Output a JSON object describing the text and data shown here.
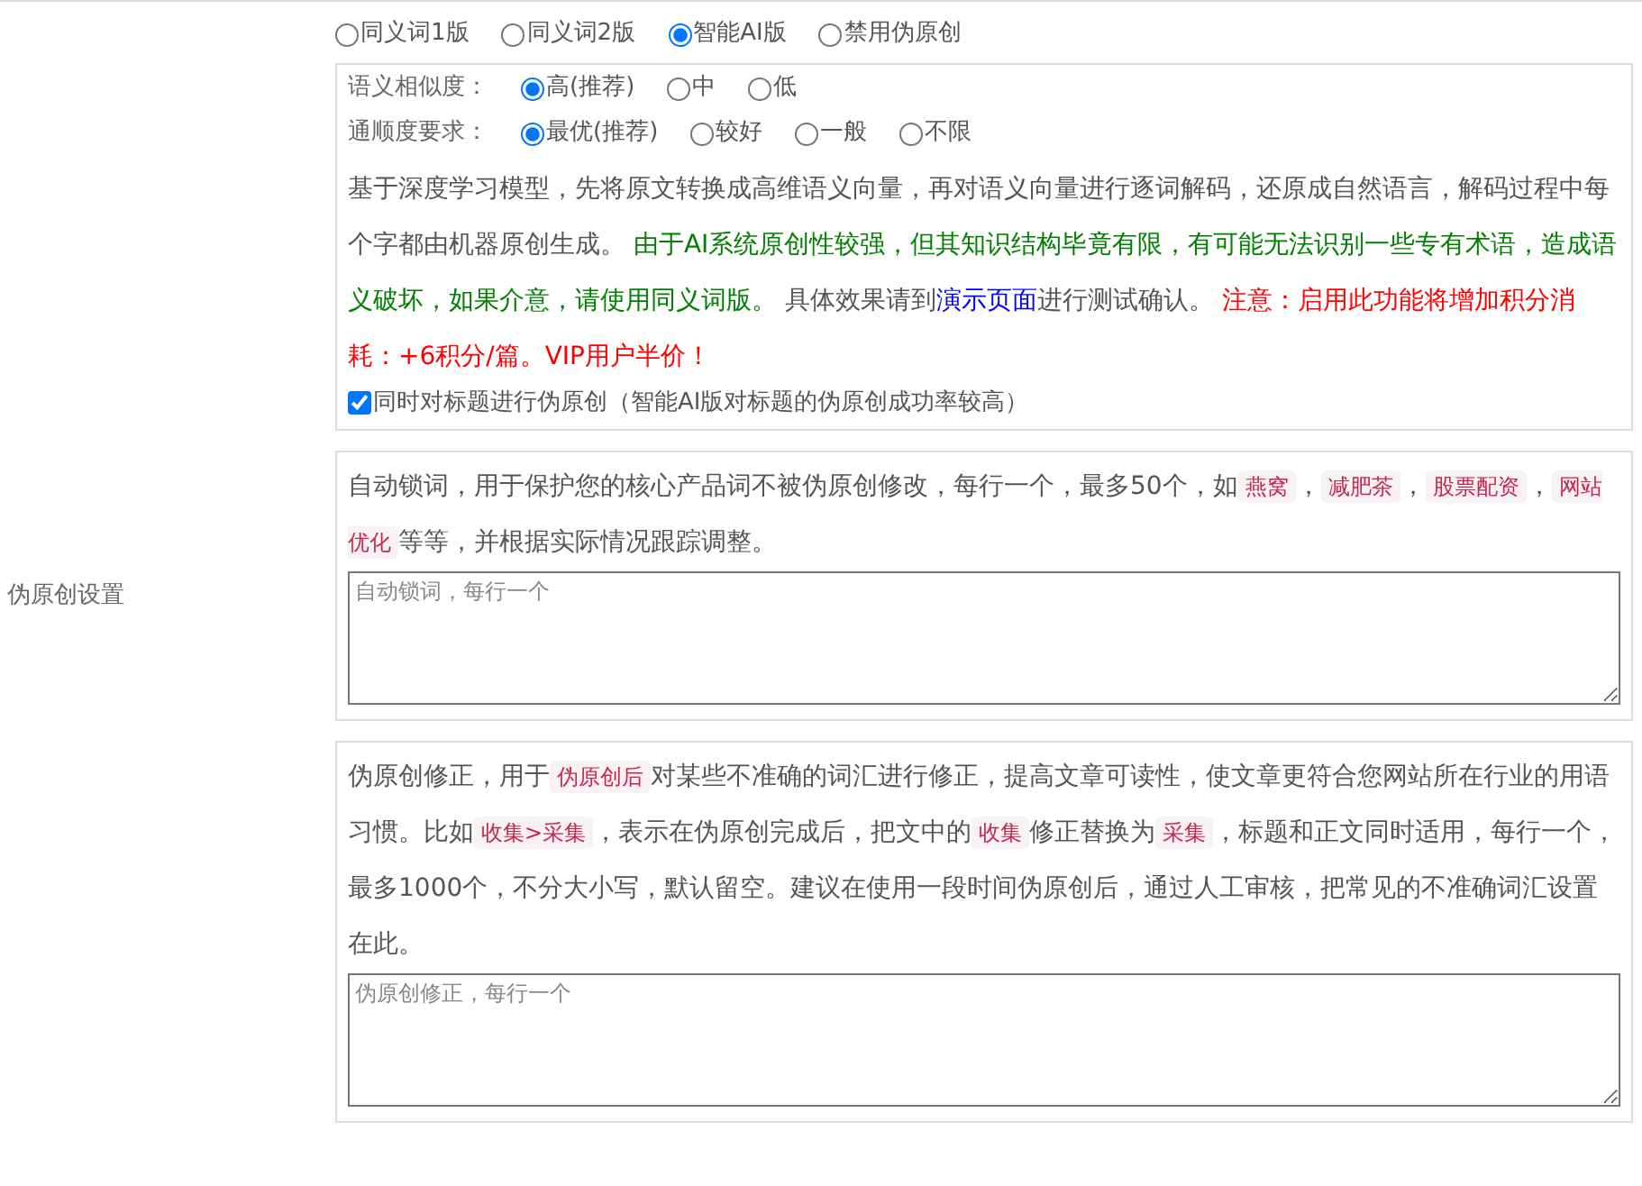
{
  "sidebar_label": "伪原创设置",
  "mode_options": [
    {
      "label": "同义词1版",
      "selected": false
    },
    {
      "label": "同义词2版",
      "selected": false
    },
    {
      "label": "智能AI版",
      "selected": true
    },
    {
      "label": "禁用伪原创",
      "selected": false
    }
  ],
  "ai_settings": {
    "similarity": {
      "label": "语义相似度：",
      "options": [
        {
          "label": "高(推荐)",
          "selected": true
        },
        {
          "label": "中",
          "selected": false
        },
        {
          "label": "低",
          "selected": false
        }
      ]
    },
    "fluency": {
      "label": "通顺度要求：",
      "options": [
        {
          "label": "最优(推荐)",
          "selected": true
        },
        {
          "label": "较好",
          "selected": false
        },
        {
          "label": "一般",
          "selected": false
        },
        {
          "label": "不限",
          "selected": false
        }
      ]
    },
    "description": [
      {
        "kind": "text",
        "text": "基于深度学习模型，先将原文转换成高维语义向量，再对语义向量进行逐词解码，还原成自然语言，解码过程中每个字都由机器原创生成。 "
      },
      {
        "kind": "green",
        "text": "由于AI系统原创性较强，但其知识结构毕竟有限，有可能无法识别一些专有术语，造成语义破坏，如果介意，请使用同义词版。"
      },
      {
        "kind": "text",
        "text": " 具体效果请到"
      },
      {
        "kind": "link",
        "text": "演示页面"
      },
      {
        "kind": "text",
        "text": "进行测试确认。 "
      },
      {
        "kind": "red",
        "text": "注意：启用此功能将增加积分消耗：+6积分/篇。VIP用户半价！"
      }
    ],
    "title_option": {
      "label": "同时对标题进行伪原创（智能AI版对标题的伪原创成功率较高）",
      "checked": true
    }
  },
  "lock_words": {
    "description": [
      {
        "kind": "text",
        "text": "自动锁词，用于保护您的核心产品词不被伪原创修改，每行一个，最多50个，如"
      },
      {
        "kind": "code",
        "text": "燕窝"
      },
      {
        "kind": "text",
        "text": "，"
      },
      {
        "kind": "code",
        "text": "减肥茶"
      },
      {
        "kind": "text",
        "text": "，"
      },
      {
        "kind": "code",
        "text": "股票配资"
      },
      {
        "kind": "text",
        "text": "，"
      },
      {
        "kind": "code",
        "text": "网站优化"
      },
      {
        "kind": "text",
        "text": "等等，并根据实际情况跟踪调整。"
      }
    ],
    "placeholder": "自动锁词，每行一个"
  },
  "correction": {
    "description": [
      {
        "kind": "text",
        "text": "伪原创修正，用于"
      },
      {
        "kind": "code",
        "text": "伪原创后"
      },
      {
        "kind": "text",
        "text": "对某些不准确的词汇进行修正，提高文章可读性，使文章更符合您网站所在行业的用语习惯。比如"
      },
      {
        "kind": "code",
        "text": "收集>采集"
      },
      {
        "kind": "text",
        "text": "，表示在伪原创完成后，把文中的"
      },
      {
        "kind": "code",
        "text": "收集"
      },
      {
        "kind": "text",
        "text": "修正替换为"
      },
      {
        "kind": "code",
        "text": "采集"
      },
      {
        "kind": "text",
        "text": "，标题和正文同时适用，每行一个，最多1000个，不分大小写，默认留空。建议在使用一段时间伪原创后，通过人工审核，把常见的不准确词汇设置在此。"
      }
    ],
    "placeholder": "伪原创修正，每行一个"
  }
}
